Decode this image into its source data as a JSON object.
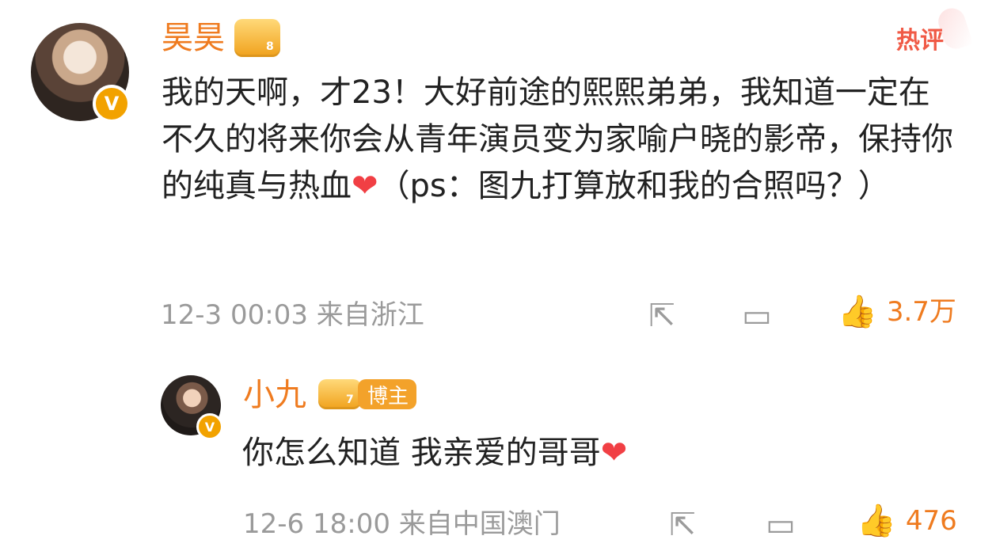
{
  "comments": {
    "main": {
      "username": "昊昊",
      "level_badge": "8",
      "hot_label": "热评",
      "text": "我的天啊，才23！大好前途的熙熙弟弟，我知道一定在不久的将来你会从青年演员变为家喻户晓的影帝，保持你的纯真与热血",
      "text_suffix": "（ps：图九打算放和我的合照吗？）",
      "emoji": "❤",
      "date_time": "12-3 00:03",
      "location": "来自浙江",
      "likes": "3.7万"
    },
    "reply": {
      "username": "小九",
      "level_badge": "7",
      "role_tag": "博主",
      "text": "你怎么知道 我亲爱的哥哥",
      "emoji": "❤",
      "date_time": "12-6 18:00",
      "location": "来自中国澳门",
      "likes": "476"
    }
  },
  "icons": {
    "share": "share-icon",
    "comment": "comment-icon",
    "like": "like-icon",
    "verified": "verified-badge-icon"
  },
  "colors": {
    "accent": "#ef7b1f",
    "hot": "#f05a46",
    "text": "#222222",
    "meta": "#9a9a9a"
  }
}
